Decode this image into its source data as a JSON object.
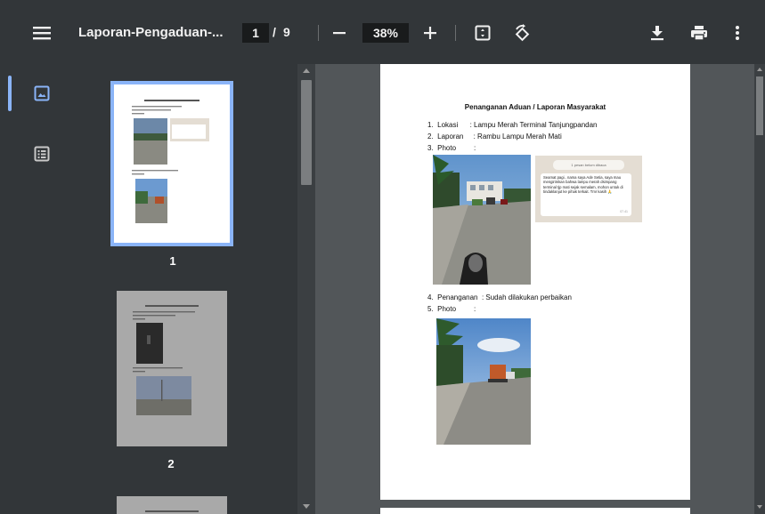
{
  "toolbar": {
    "title": "Laporan-Pengaduan-...",
    "current_page": "1",
    "page_separator": "/",
    "total_pages": "9",
    "zoom": "38%"
  },
  "sidebar": {
    "thumbnails": [
      {
        "number": "1",
        "selected": true
      },
      {
        "number": "2",
        "selected": false
      }
    ],
    "active_color": "#8ab4f8"
  },
  "document": {
    "title": "Penanganan Aduan / Laporan Masyarakat",
    "lines": [
      "1.  Lokasi      : Lampu Merah Terminal Tanjungpandan",
      "2.  Laporan     : Rambu Lampu Merah Mati",
      "3.  Photo         :",
      "4.  Penanganan  : Sudah dilakukan perbaikan",
      "5.  Photo         :"
    ],
    "chat": {
      "header": "1 pesan belum dibaca",
      "message": "Seamat pagi.. nama saya Ade Setia, saya mau mengirimkan bahwa lampu merah dsimpang terminal tjp mati sejak semalam, mohon untuk di tindaklanjut ke pihak terkait. Tmr kasih 🙏",
      "time": "07.41"
    }
  },
  "colors": {
    "toolbar_bg": "#323639",
    "viewer_bg": "#525659",
    "accent": "#8ab4f8"
  }
}
